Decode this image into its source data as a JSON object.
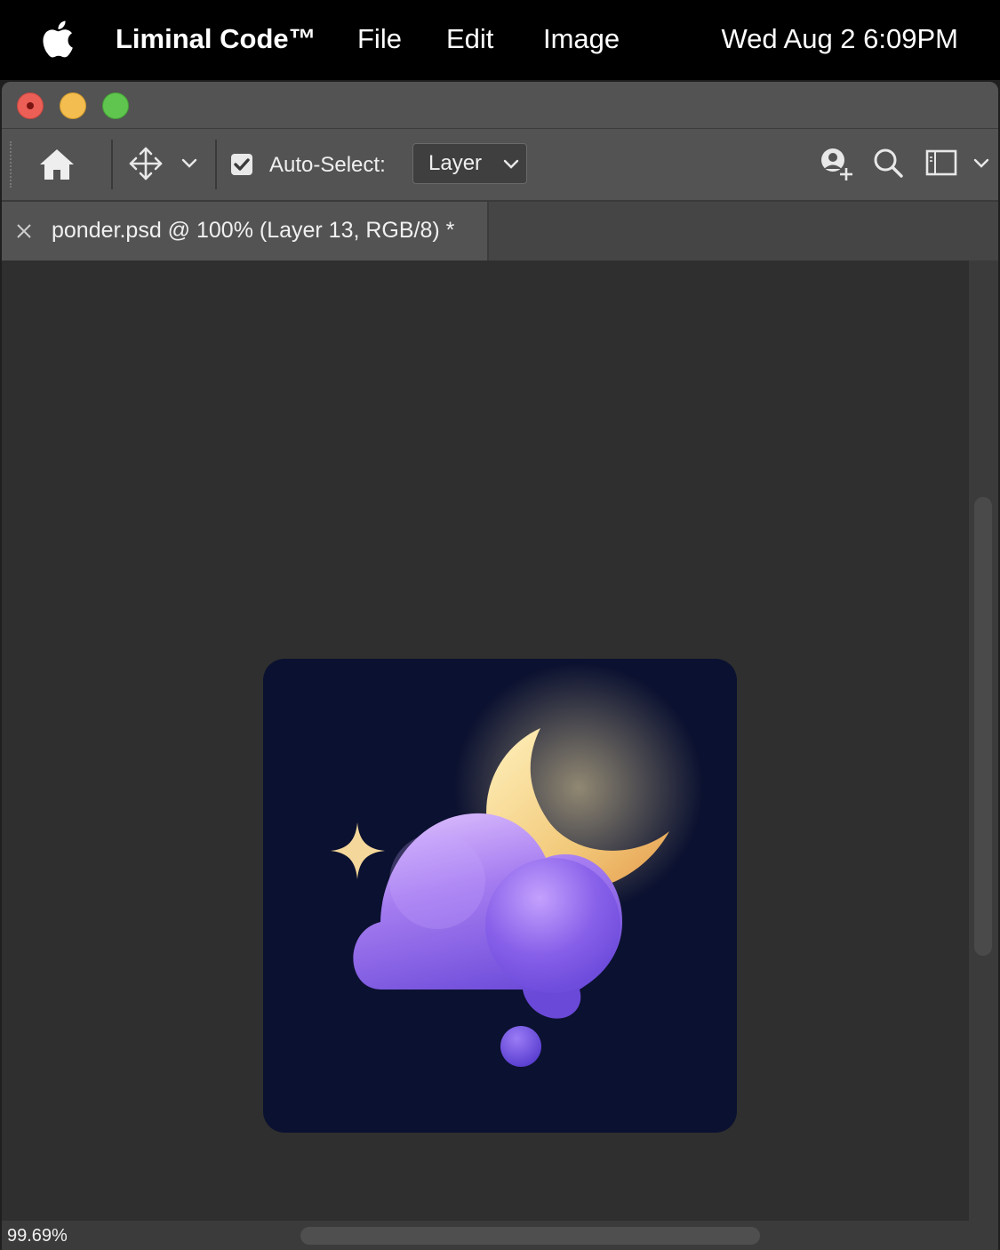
{
  "menubar": {
    "apple_icon": "apple-logo-icon",
    "app_name": "Liminal Code™",
    "items": [
      "File",
      "Edit",
      "Image"
    ],
    "clock": "Wed Aug 2 6:09PM"
  },
  "window": {
    "traffic_lights": [
      "close",
      "minimize",
      "zoom"
    ]
  },
  "toolbar": {
    "home_icon": "home-icon",
    "move_tool_icon": "move-tool-icon",
    "auto_select_checked": true,
    "auto_select_label": "Auto-Select:",
    "auto_select_target": "Layer",
    "right_icons": [
      "share-user-icon",
      "search-icon",
      "workspace-icon"
    ]
  },
  "document": {
    "tab_title": "ponder.psd @ 100% (Layer 13, RGB/8) *"
  },
  "artwork": {
    "background_color": "#0b1130",
    "elements": [
      "sparkle-star",
      "crescent-moon",
      "thought-cloud",
      "thought-bubble-dot"
    ]
  },
  "status": {
    "zoom": "99.69%"
  },
  "colors": {
    "menubar": "#000000",
    "chrome": "#535353",
    "canvas": "#2f2f2f",
    "close": "#ec5f57",
    "minimize": "#f4bd4f",
    "zoom": "#5fc54f"
  }
}
